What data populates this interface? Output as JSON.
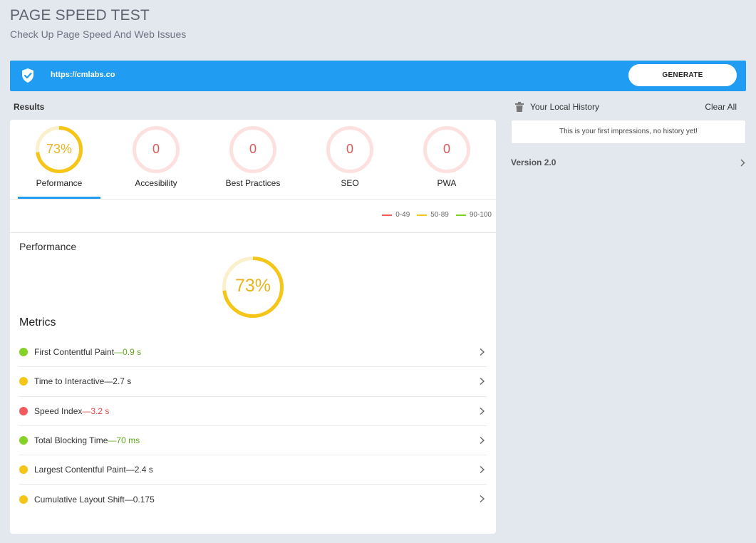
{
  "header": {
    "title": "PAGE SPEED TEST",
    "subtitle": "Check Up Page Speed And Web Issues"
  },
  "url_bar": {
    "icon": "shield-check-icon",
    "url": "https://cmlabs.co",
    "generate_label": "GENERATE",
    "color": "#209cf2"
  },
  "results": {
    "label": "Results",
    "tabs": [
      {
        "label": "Peformance",
        "score": "73%",
        "score_fraction": 0.73,
        "color": "#f5c518",
        "active": true
      },
      {
        "label": "Accesibility",
        "score": "0",
        "score_fraction": 0,
        "color": "#e15759",
        "active": false
      },
      {
        "label": "Best Practices",
        "score": "0",
        "score_fraction": 0,
        "color": "#e15759",
        "active": false
      },
      {
        "label": "SEO",
        "score": "0",
        "score_fraction": 0,
        "color": "#e15759",
        "active": false
      },
      {
        "label": "PWA",
        "score": "0",
        "score_fraction": 0,
        "color": "#e15759",
        "active": false
      }
    ],
    "legend": [
      {
        "label": "0-49",
        "color": "#f25b5b"
      },
      {
        "label": "50-89",
        "color": "#f5c518"
      },
      {
        "label": "90-100",
        "color": "#7ed321"
      }
    ],
    "section_title": "Performance",
    "big_score": "73%",
    "big_score_fraction": 0.73,
    "metrics_title": "Metrics",
    "metrics": [
      {
        "name": "First Contentful Paint",
        "value": "—0.9 s",
        "status": "good",
        "dot_color": "#86d125",
        "value_color": "#5fa81c"
      },
      {
        "name": "Time to Interactive",
        "value": "—2.7 s",
        "status": "average",
        "dot_color": "#f5c518",
        "value_color": "#333333"
      },
      {
        "name": "Speed Index",
        "value": "—3.2 s",
        "status": "poor",
        "dot_color": "#f25b5b",
        "value_color": "#e04848"
      },
      {
        "name": "Total Blocking Time",
        "value": "—70 ms",
        "status": "good",
        "dot_color": "#86d125",
        "value_color": "#5fa81c"
      },
      {
        "name": "Largest Contentful Paint",
        "value": "—2.4 s",
        "status": "average",
        "dot_color": "#f5c518",
        "value_color": "#333333"
      },
      {
        "name": "Cumulative Layout Shift",
        "value": "—0.175",
        "status": "average",
        "dot_color": "#f5c518",
        "value_color": "#333333"
      }
    ]
  },
  "history": {
    "icon": "trash-icon",
    "title": "Your Local History",
    "clear_label": "Clear All",
    "empty_message": "This is your first impressions, no history yet!",
    "version_label": "Version 2.0"
  }
}
